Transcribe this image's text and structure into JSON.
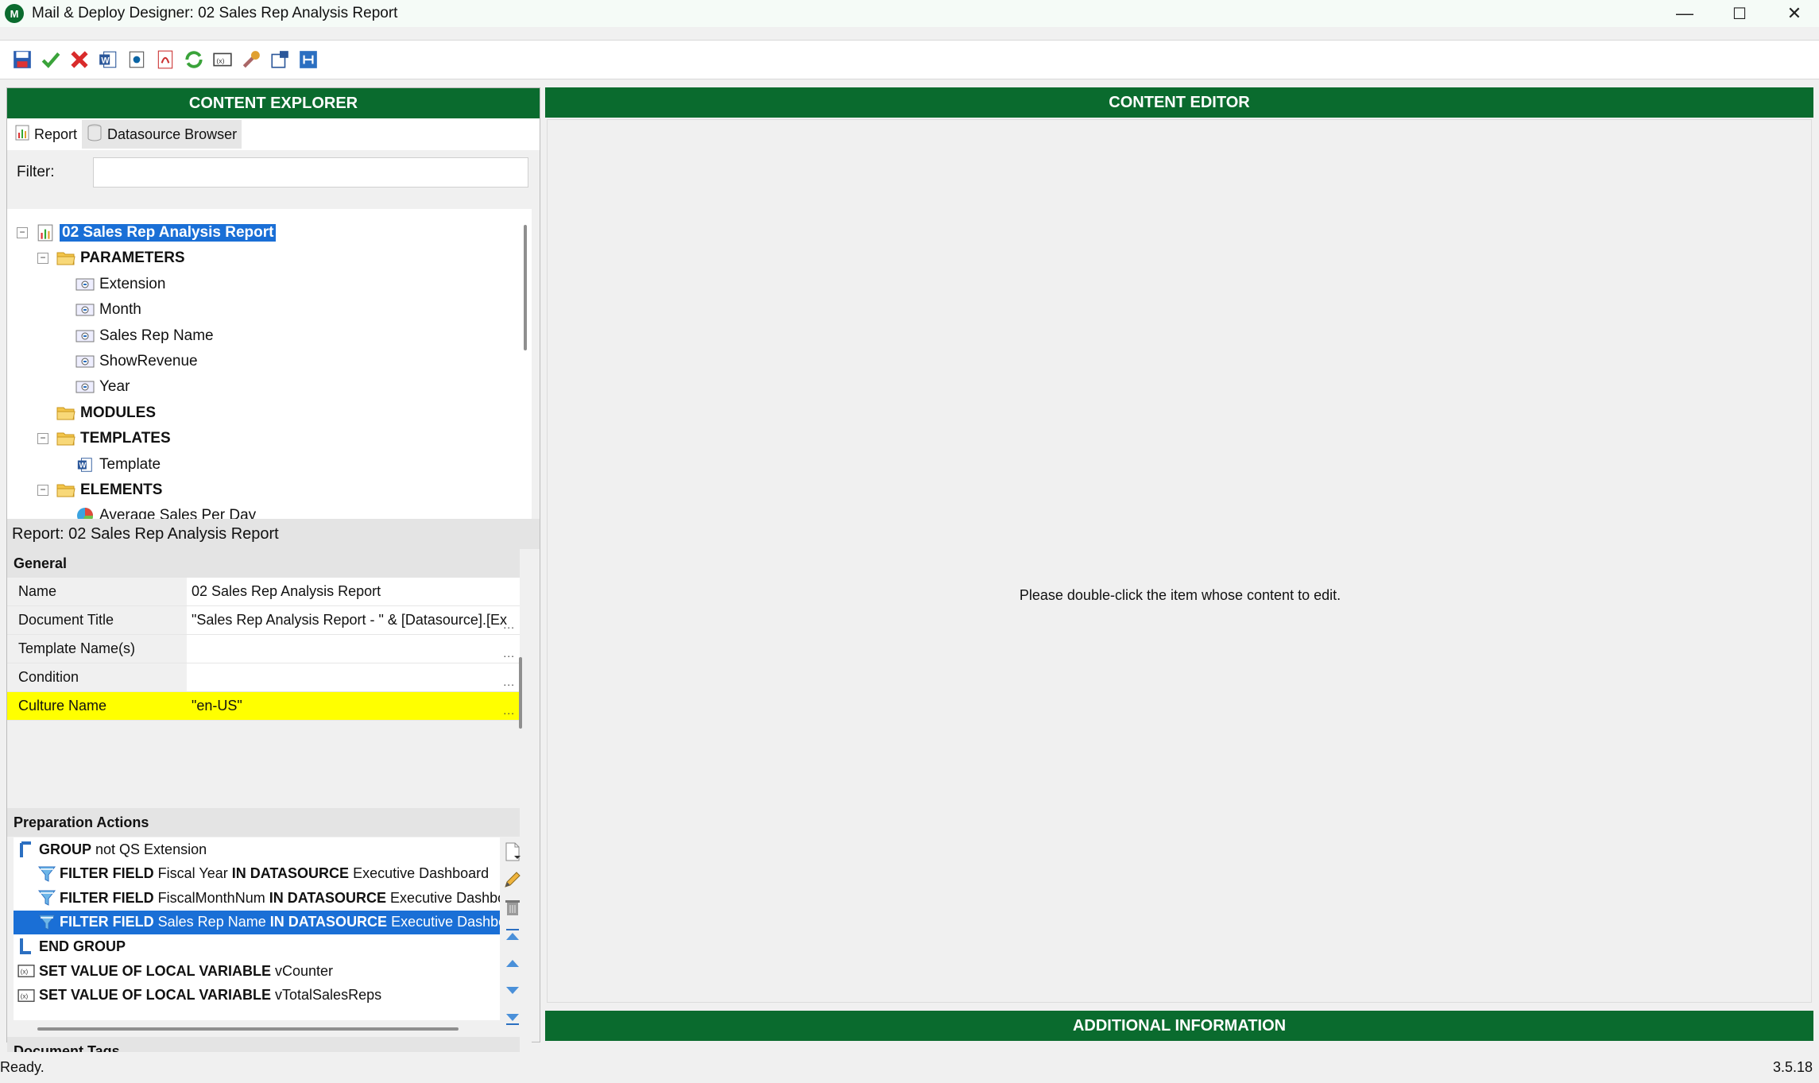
{
  "window": {
    "title": "Mail & Deploy Designer: 02 Sales Rep Analysis Report",
    "app_icon_letter": "M",
    "minimize": "—",
    "maximize": "☐",
    "close": "✕"
  },
  "toolbar": {
    "buttons": [
      "save-icon",
      "check-icon",
      "cancel-icon",
      "word-icon",
      "outlook-icon",
      "pdf-icon",
      "refresh-icon",
      "variable-icon",
      "tools-icon",
      "export-icon",
      "hierarchy-icon"
    ]
  },
  "explorer": {
    "header": "CONTENT EXPLORER",
    "tabs": [
      "Report",
      "Datasource Browser"
    ],
    "filter_label": "Filter:",
    "filter_value": "",
    "tree": [
      {
        "label": "02 Sales Rep Analysis Report",
        "level": 0,
        "icon": "report-icon",
        "expander": "⊟",
        "bold": true,
        "selected": true
      },
      {
        "label": "PARAMETERS",
        "level": 1,
        "icon": "folder-icon",
        "expander": "⊟",
        "bold": true
      },
      {
        "label": "Extension",
        "level": 2,
        "icon": "parameter-icon"
      },
      {
        "label": "Month",
        "level": 2,
        "icon": "parameter-icon"
      },
      {
        "label": "Sales Rep Name",
        "level": 2,
        "icon": "parameter-icon"
      },
      {
        "label": "ShowRevenue",
        "level": 2,
        "icon": "parameter-icon"
      },
      {
        "label": "Year",
        "level": 2,
        "icon": "parameter-icon"
      },
      {
        "label": "MODULES",
        "level": 1,
        "icon": "folder-icon",
        "bold": true
      },
      {
        "label": "TEMPLATES",
        "level": 1,
        "icon": "folder-icon",
        "expander": "⊟",
        "bold": true
      },
      {
        "label": "Template",
        "level": 2,
        "icon": "word-template-icon"
      },
      {
        "label": "ELEMENTS",
        "level": 1,
        "icon": "folder-icon",
        "expander": "⊟",
        "bold": true
      },
      {
        "label": "Average Sales Per Day",
        "level": 2,
        "icon": "chart-icon"
      }
    ]
  },
  "properties": {
    "title": "Report: 02 Sales Rep Analysis Report",
    "general_header": "General",
    "rows": [
      {
        "name": "Name",
        "value": "02 Sales Rep Analysis Report",
        "ellipsis": ""
      },
      {
        "name": "Document Title",
        "value": "\"Sales Rep Analysis Report - \" & [Datasource].[Ex",
        "ellipsis": "..."
      },
      {
        "name": "Template Name(s)",
        "value": "",
        "ellipsis": "..."
      },
      {
        "name": "Condition",
        "value": "",
        "ellipsis": "..."
      },
      {
        "name": "Culture Name",
        "value": "\"en-US\"",
        "ellipsis": "...",
        "highlight": true
      }
    ],
    "prep_header": "Preparation Actions",
    "actions": [
      {
        "indent": 0,
        "icon": "group-start-icon",
        "keyword": "GROUP",
        "rest": [
          {
            "t": " not QS Extension",
            "b": false
          }
        ]
      },
      {
        "indent": 1,
        "icon": "filter-icon",
        "keyword": "FILTER FIELD",
        "rest": [
          {
            "t": " Fiscal Year ",
            "b": false
          },
          {
            "t": "IN DATASOURCE",
            "b": true
          },
          {
            "t": " Executive Dashboard",
            "b": false
          }
        ]
      },
      {
        "indent": 1,
        "icon": "filter-icon",
        "keyword": "FILTER FIELD",
        "rest": [
          {
            "t": " FiscalMonthNum ",
            "b": false
          },
          {
            "t": "IN DATASOURCE",
            "b": true
          },
          {
            "t": " Executive Dashbo",
            "b": false
          }
        ]
      },
      {
        "indent": 1,
        "icon": "filter-icon",
        "keyword": "FILTER FIELD",
        "rest": [
          {
            "t": " Sales Rep Name ",
            "b": false
          },
          {
            "t": "IN DATASOURCE",
            "b": true
          },
          {
            "t": " Executive Dashboa",
            "b": false
          }
        ],
        "selected": true
      },
      {
        "indent": 0,
        "icon": "group-end-icon",
        "keyword": "END GROUP",
        "rest": []
      },
      {
        "indent": 0,
        "icon": "variable-icon",
        "keyword": "SET VALUE OF LOCAL VARIABLE",
        "rest": [
          {
            "t": " vCounter",
            "b": false
          }
        ]
      },
      {
        "indent": 0,
        "icon": "variable-icon",
        "keyword": "SET VALUE OF LOCAL VARIABLE",
        "rest": [
          {
            "t": " vTotalSalesReps",
            "b": false
          }
        ]
      }
    ],
    "action_tools": [
      "new-icon",
      "edit-icon",
      "delete-icon",
      "move-top-icon",
      "move-up-icon",
      "move-down-icon",
      "move-bottom-icon"
    ],
    "tags_header": "Document Tags",
    "tag_tools": [
      "new-icon",
      "edit-icon"
    ]
  },
  "editor": {
    "header": "CONTENT EDITOR",
    "message": "Please double-click the item whose content to edit.",
    "additional_header": "ADDITIONAL INFORMATION"
  },
  "status": {
    "left": "Ready.",
    "version": "3.5.18"
  },
  "colors": {
    "header_green": "#0a6b2e",
    "selection_blue": "#1a6fd6",
    "highlight_yellow": "#ffff00"
  }
}
